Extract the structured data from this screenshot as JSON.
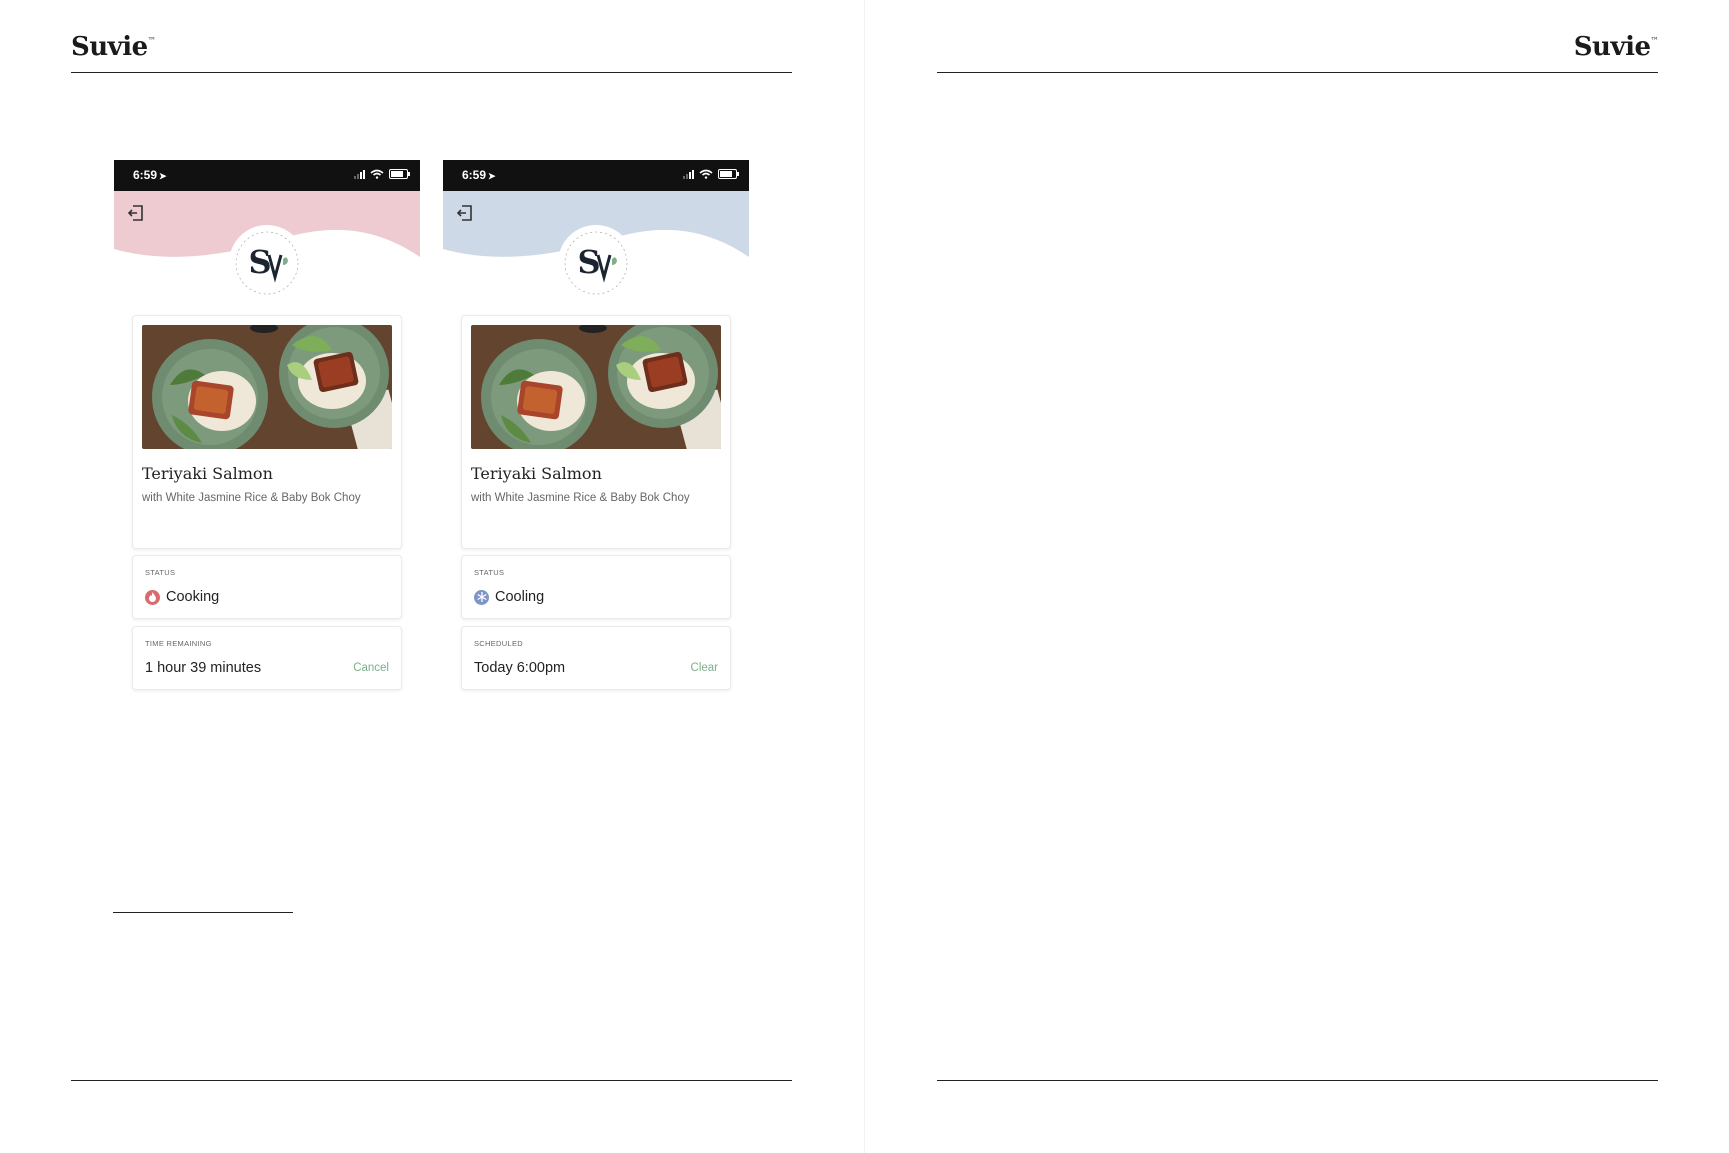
{
  "brand": {
    "name": "Suvie",
    "trademark": "™"
  },
  "screens": [
    {
      "status_bar_time": "6:59",
      "header_color": "#edcbd0",
      "meal": {
        "title": "Teriyaki Salmon",
        "subtitle": "with White Jasmine Rice & Baby Bok Choy"
      },
      "status": {
        "label": "STATUS",
        "value": "Cooking",
        "icon": "flame-icon",
        "color": "#d96b6f"
      },
      "timer": {
        "label": "TIME REMAINING",
        "value": "1 hour 39 minutes",
        "action": "Cancel"
      }
    },
    {
      "status_bar_time": "6:59",
      "header_color": "#cdd9e6",
      "meal": {
        "title": "Teriyaki Salmon",
        "subtitle": "with White Jasmine Rice & Baby Bok Choy"
      },
      "status": {
        "label": "STATUS",
        "value": "Cooling",
        "icon": "snowflake-icon",
        "color": "#7d95c7"
      },
      "timer": {
        "label": "SCHEDULED",
        "value": "Today 6:00pm",
        "action": "Clear"
      }
    }
  ]
}
